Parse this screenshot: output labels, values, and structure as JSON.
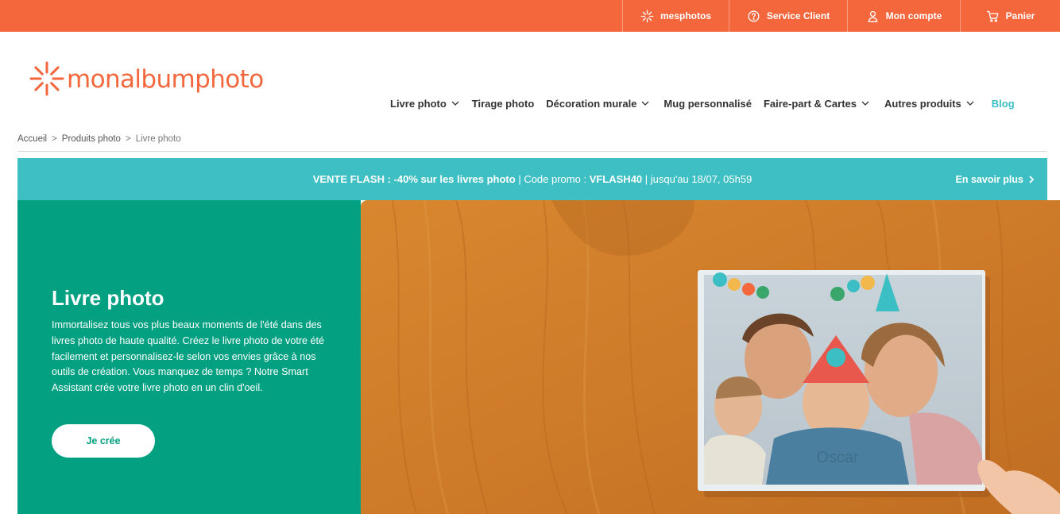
{
  "topbar": {
    "items": [
      {
        "label": "mesphotos",
        "icon": "sparkle-icon"
      },
      {
        "label": "Service Client",
        "icon": "help-circle-icon"
      },
      {
        "label": "Mon compte",
        "icon": "user-icon"
      },
      {
        "label": "Panier",
        "icon": "cart-icon"
      }
    ]
  },
  "brand": {
    "name": "monalbumphoto",
    "color": "#f4673d"
  },
  "nav": {
    "items": [
      {
        "label": "Livre photo",
        "dropdown": true
      },
      {
        "label": "Tirage photo",
        "dropdown": false
      },
      {
        "label": "Décoration murale",
        "dropdown": true
      },
      {
        "label": "Mug personnalisé",
        "dropdown": false
      },
      {
        "label": "Faire-part & Cartes",
        "dropdown": true
      },
      {
        "label": "Autres produits",
        "dropdown": true
      },
      {
        "label": "Blog",
        "dropdown": false
      }
    ]
  },
  "breadcrumb": {
    "items": [
      "Accueil",
      "Produits photo",
      "Livre photo"
    ],
    "separator": ">"
  },
  "promo": {
    "headline": "VENTE FLASH : -40% sur les livres photo",
    "separator": " | ",
    "code_label": "Code promo : ",
    "code": "VFLASH40",
    "validity": " | jusqu'au 18/07, 05h59",
    "link": "En savoir plus",
    "bg_color": "#3ebfc3"
  },
  "hero": {
    "title": "Livre photo",
    "description": "Immortalisez tous vos plus beaux moments de l'été dans des livres photo de haute qualité. Créez le livre photo de votre été facilement et personnalisez-le selon vos envies grâce à nos outils de création. Vous manquez de temps ? Notre Smart Assistant crée votre livre photo en un clin d'oeil.",
    "cta": "Je crée",
    "bg_color": "#03a081",
    "image_caption": "Oscar"
  }
}
